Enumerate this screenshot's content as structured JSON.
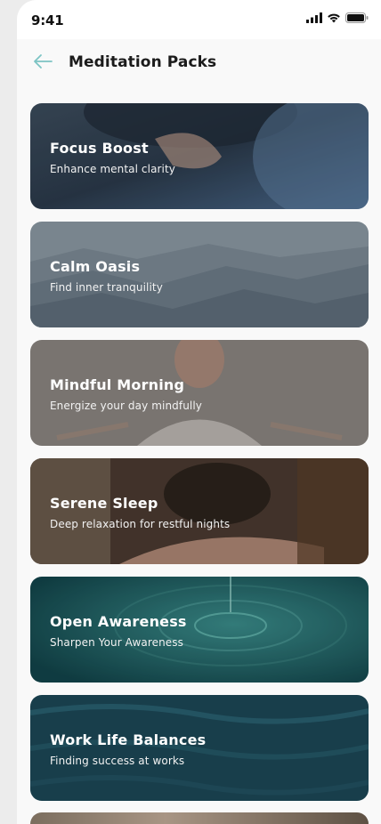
{
  "status": {
    "time": "9:41"
  },
  "header": {
    "title": "Meditation Packs"
  },
  "packs": [
    {
      "name": "Focus Boost",
      "description": "Enhance mental clarity"
    },
    {
      "name": "Calm Oasis",
      "description": "Find inner tranquility"
    },
    {
      "name": "Mindful Morning",
      "description": "Energize your day mindfully"
    },
    {
      "name": "Serene Sleep",
      "description": "Deep relaxation for restful nights"
    },
    {
      "name": "Open Awareness",
      "description": "Sharpen Your Awareness"
    },
    {
      "name": "Work Life Balances",
      "description": "Finding success at works"
    }
  ],
  "colors": {
    "accent": "#7cc4c4",
    "title": "#1b1b1b"
  }
}
